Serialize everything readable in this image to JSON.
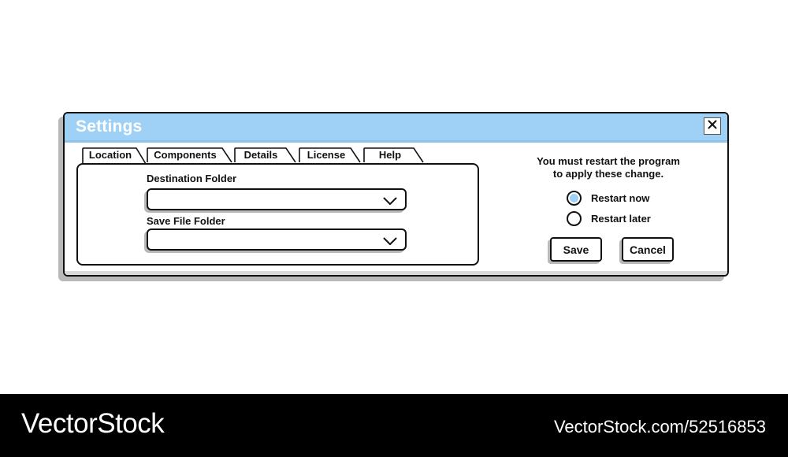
{
  "window": {
    "title": "Settings",
    "close_glyph": "✕"
  },
  "tabs": [
    {
      "label": "Location",
      "active": true
    },
    {
      "label": "Components",
      "active": false
    },
    {
      "label": "Details",
      "active": false
    },
    {
      "label": "License",
      "active": false
    },
    {
      "label": "Help",
      "active": false
    }
  ],
  "location": {
    "destination_label": "Destination Folder",
    "destination_value": "",
    "save_label": "Save File Folder",
    "save_value": ""
  },
  "restart": {
    "notice_line1": "You must restart the program",
    "notice_line2": "to apply these change.",
    "options": [
      {
        "label": "Restart now",
        "selected": true
      },
      {
        "label": "Restart later",
        "selected": false
      }
    ]
  },
  "buttons": {
    "save_label": "Save",
    "cancel_label": "Cancel"
  },
  "footer": {
    "brand": "VectorStock",
    "image_id": "VectorStock.com/52516853"
  },
  "colors": {
    "accent": "#9fd0f5",
    "shadow": "#b9b9b9",
    "outline": "#111111"
  },
  "icons": {
    "close": "close-icon",
    "dropdown": "chevron-down-icon",
    "radio_selected": "radio-selected-icon",
    "radio_unselected": "radio-unselected-icon"
  }
}
